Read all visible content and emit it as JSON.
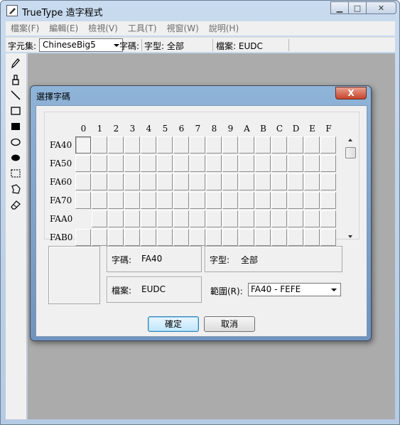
{
  "window": {
    "title": "TrueType 造字程式"
  },
  "menu": [
    "檔案(F)",
    "編輯(E)",
    "檢視(V)",
    "工具(T)",
    "視窗(W)",
    "說明(H)"
  ],
  "toolbar": {
    "charset_label": "字元集:",
    "charset_value": "ChineseBig5",
    "code_label": "字碼:",
    "font_label": "字型: 全部",
    "file_label": "檔案: EUDC"
  },
  "dialog": {
    "title": "選擇字碼",
    "close": "X",
    "columns": [
      "0",
      "1",
      "2",
      "3",
      "4",
      "5",
      "6",
      "7",
      "8",
      "9",
      "A",
      "B",
      "C",
      "D",
      "E",
      "F"
    ],
    "rows": [
      "FA40",
      "FA50",
      "FA60",
      "FA70",
      "FAA0",
      "FAB0"
    ],
    "info": {
      "code_label": "字碼:",
      "code_value": "FA40",
      "font_label": "字型:",
      "font_value": "全部",
      "file_label": "檔案:",
      "file_value": "EUDC",
      "range_label": "範圍(R):",
      "range_value": "FA40 - FEFE"
    },
    "ok_label": "確定",
    "cancel_label": "取消"
  }
}
